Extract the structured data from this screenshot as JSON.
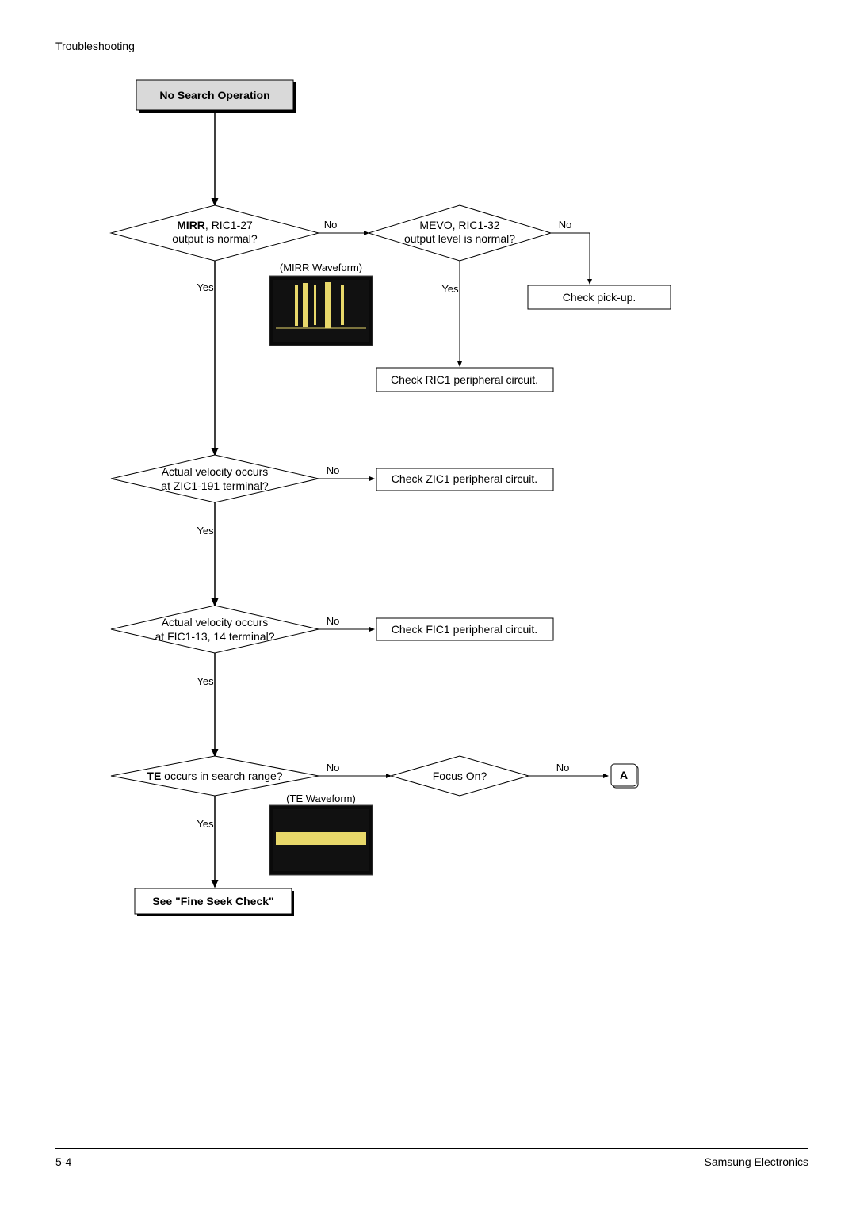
{
  "header": {
    "title": "Troubleshooting"
  },
  "footer": {
    "page": "5-4",
    "company": "Samsung Electronics"
  },
  "flowchart": {
    "start": {
      "label": "No Search Operation"
    },
    "d1": {
      "prefix": "MIRR",
      "suffix": ", RIC1-27",
      "line2": "output is normal?"
    },
    "d1_waveform_caption": "(MIRR Waveform)",
    "d2": {
      "line1": "MEVO, RIC1-32",
      "line2": "output level is normal?"
    },
    "p_checkpickup": "Check pick-up.",
    "p_checkric1": "Check RIC1 peripheral circuit.",
    "d3": {
      "line1": "Actual velocity occurs",
      "line2": "at ZIC1-191 terminal?"
    },
    "p_checkzic1": "Check ZIC1 peripheral circuit.",
    "d4": {
      "line1": "Actual velocity occurs",
      "line2": "at FIC1-13, 14 terminal?"
    },
    "p_checkfic1": "Check FIC1 peripheral circuit.",
    "d5": {
      "prefix": "TE",
      "suffix": " occurs in search range?"
    },
    "d5_waveform_caption": "(TE Waveform)",
    "d6": {
      "line1": "Focus On?"
    },
    "terminal_A": "A",
    "end": {
      "label": "See \"Fine Seek Check\""
    },
    "labels": {
      "yes": "Yes",
      "no": "No"
    }
  }
}
